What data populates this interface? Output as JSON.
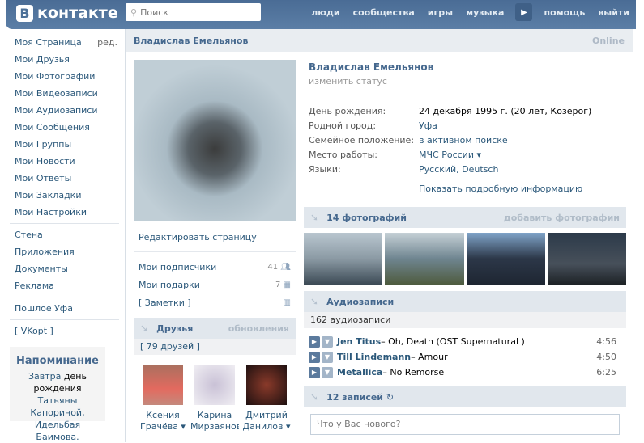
{
  "header": {
    "logo": "ВКонтакте",
    "logo_letter": "В",
    "logo_text": "контакте",
    "search_placeholder": "Поиск",
    "nav": [
      "люди",
      "сообщества",
      "игры",
      "музыка",
      "помощь",
      "выйти"
    ]
  },
  "sidebar": {
    "items": [
      "Моя Страница",
      "Мои Друзья",
      "Мои Фотографии",
      "Мои Видеозаписи",
      "Мои Аудиозаписи",
      "Мои Сообщения",
      "Мои Группы",
      "Мои Новости",
      "Мои Ответы",
      "Мои Закладки",
      "Мои Настройки"
    ],
    "edit": "ред.",
    "items2": [
      "Стена",
      "Приложения",
      "Документы",
      "Реклама"
    ],
    "city": "Пошлое Уфа",
    "vkopt": "[ VKopt ]"
  },
  "reminder": {
    "title": "Напоминание",
    "t1": "Завтра",
    "t2": "день рождения",
    "t3": "Татьяны Капориной, Идельбая Баимова."
  },
  "profile": {
    "title_name": "Владислав Емельянов",
    "online": "Online",
    "name": "Владислав Емельянов",
    "status": "изменить статус",
    "info": [
      {
        "k": "День рождения:",
        "v": "24 декабря 1995 г. (20 лет, Козерог)"
      },
      {
        "k": "Родной город:",
        "v": "Уфа"
      },
      {
        "k": "Семейное положение:",
        "v": "в активном поиске"
      },
      {
        "k": "Место работы:",
        "v": "МЧС России ▾"
      },
      {
        "k": "Языки:",
        "v": "Русский, Deutsch"
      }
    ],
    "more": "Показать подробную информацию"
  },
  "left": {
    "edit": "Редактировать страницу",
    "subs": "Мои подписчики",
    "subs_count": "41",
    "gifts": "Мои подарки",
    "gifts_count": "7",
    "notes": "[ Заметки ]"
  },
  "friends": {
    "title": "Друзья",
    "updates": "обновления",
    "count": "[ 79 друзей ]",
    "list": [
      {
        "first": "Ксения",
        "last": "Грачёва ▾"
      },
      {
        "first": "Карина",
        "last": "Мирзаянова ▾"
      },
      {
        "first": "Дмитрий",
        "last": "Данилов ▾"
      }
    ]
  },
  "photos": {
    "title": "14 фотографий",
    "add": "добавить фотографии"
  },
  "audio": {
    "title": "Аудиозаписи",
    "count": "162 аудиозаписи",
    "tracks": [
      {
        "artist": "Jen Titus",
        "song": " – Oh, Death (OST Supernatural )",
        "dur": "4:56"
      },
      {
        "artist": "Till Lindemann",
        "song": " – Amour",
        "dur": "4:50"
      },
      {
        "artist": "Metallica",
        "song": " – No Remorse",
        "dur": "6:25"
      }
    ]
  },
  "wall": {
    "title": "12 записей",
    "placeholder": "Что у Вас нового?"
  }
}
